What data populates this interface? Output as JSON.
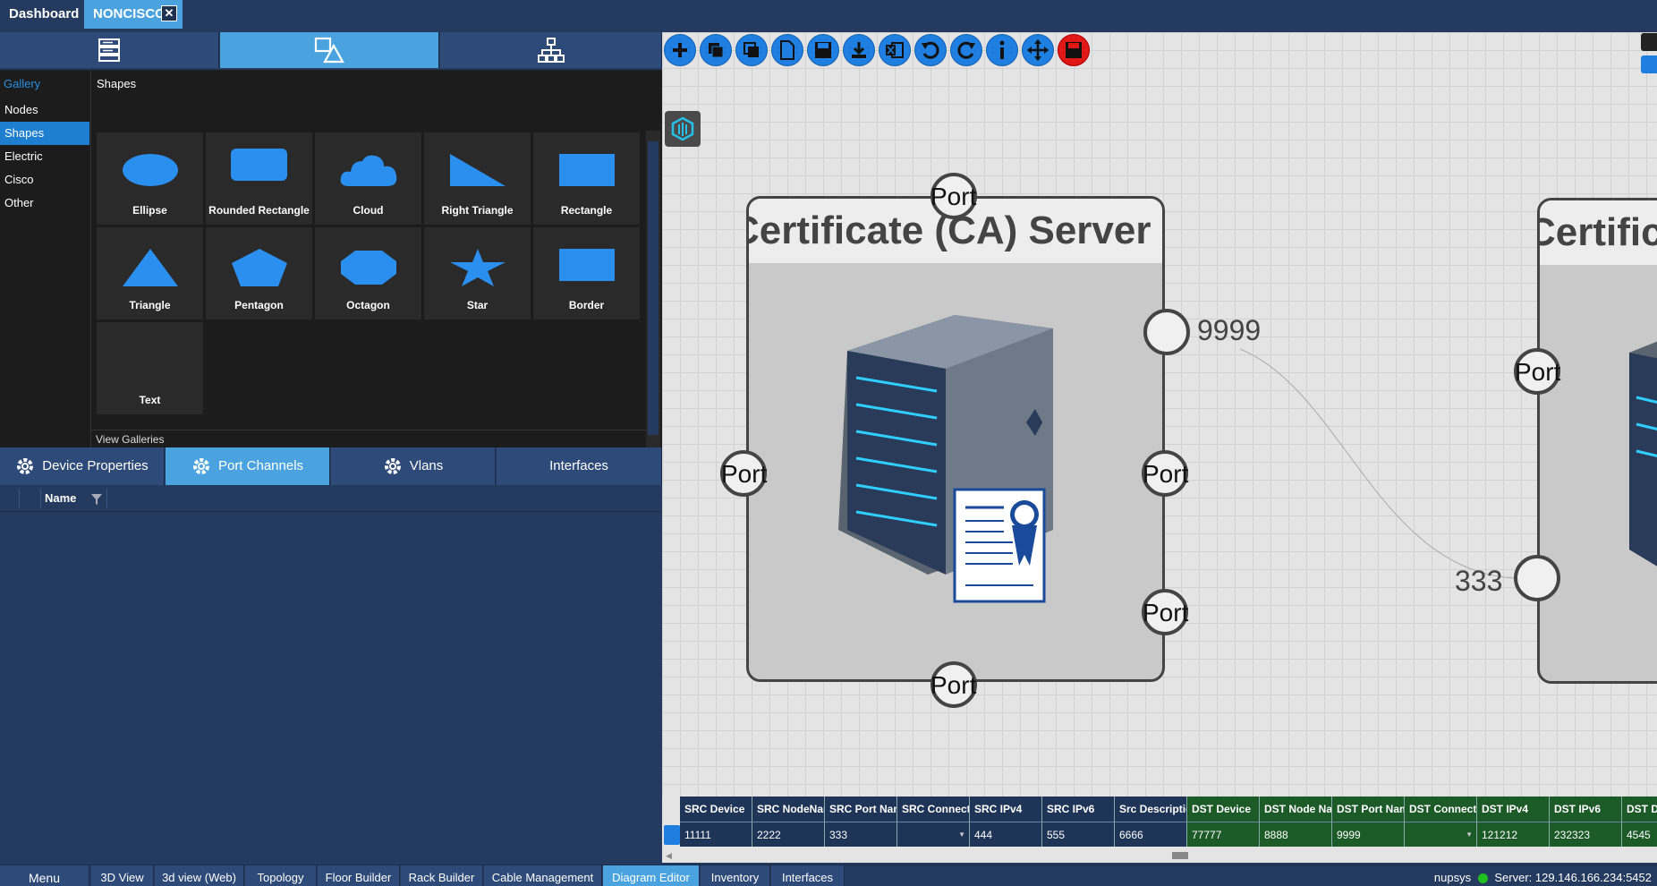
{
  "top_tabs": {
    "dashboard": "Dashboard",
    "active": "NONCISCO",
    "close": "✕"
  },
  "gallery": {
    "heading": "Gallery",
    "section_title": "Shapes",
    "categories": [
      "Nodes",
      "Shapes",
      "Electric",
      "Cisco",
      "Other"
    ],
    "selected_category": "Shapes",
    "shapes": [
      "Ellipse",
      "Rounded Rectangle",
      "Cloud",
      "Right Triangle",
      "Rectangle",
      "Triangle",
      "Pentagon",
      "Octagon",
      "Star",
      "Border",
      "Text"
    ],
    "view_galleries": "View Galleries",
    "accent": "#2a8ee0"
  },
  "property_tabs": [
    "Device Properties",
    "Port Channels",
    "Vlans",
    "Interfaces"
  ],
  "active_property_tab": "Port Channels",
  "grid": {
    "name_header": "Name"
  },
  "toolbar": {
    "icons": [
      "add-icon",
      "copy-icon",
      "duplicate-icon",
      "new-document-icon",
      "save-icon",
      "download-icon",
      "excel-icon",
      "undo-icon",
      "redo-icon",
      "info-icon",
      "move-icon",
      "save-red-icon"
    ]
  },
  "diagram": {
    "device1_title": "Certificate (CA) Server",
    "device2_title": "Certificate",
    "port_label": "Port",
    "port_num_a": "9999",
    "port_num_b": "333"
  },
  "connection_table": {
    "headers": [
      "SRC Device",
      "SRC NodeName",
      "SRC Port Name",
      "SRC Connection",
      "SRC IPv4",
      "SRC IPv6",
      "Src Description",
      "DST Device",
      "DST Node Name",
      "DST Port Name",
      "DST Connection",
      "DST IPv4",
      "DST IPv6",
      "DST Description"
    ],
    "row": [
      "11111",
      "2222",
      "333",
      "",
      "444",
      "555",
      "6666",
      "77777",
      "8888",
      "9999",
      "",
      "121212",
      "232323",
      "4545"
    ]
  },
  "bottom_tabs": [
    "3D View",
    "3d view (Web)",
    "Topology",
    "Floor Builder",
    "Rack Builder",
    "Cable Management",
    "Diagram Editor",
    "Inventory",
    "Interfaces"
  ],
  "active_bottom_tab": "Diagram Editor",
  "menu_label": "Menu",
  "status": {
    "user": "nupsys",
    "server": "Server: 129.146.166.234:5452",
    "status_color": "#1fc01f"
  }
}
